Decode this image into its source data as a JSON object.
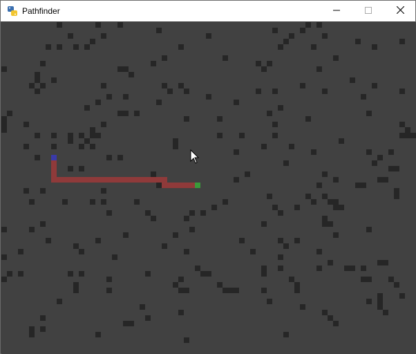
{
  "window": {
    "title": "Pathfinder",
    "icon": "python-icon",
    "controls": [
      "minimize-icon",
      "maximize-icon",
      "close-icon"
    ]
  },
  "grid": {
    "cell_size": 8,
    "cols": 75,
    "rows": 60,
    "colors": {
      "background": "#414141",
      "wall": "#262626",
      "path": "#8f3a3a",
      "start": "#3a3aa8",
      "end": "#3a9a3a"
    },
    "walls": [
      [
        10,
        0
      ],
      [
        17,
        0
      ],
      [
        21,
        0
      ],
      [
        55,
        0
      ],
      [
        57,
        0
      ],
      [
        28,
        1
      ],
      [
        49,
        1
      ],
      [
        54,
        1
      ],
      [
        12,
        2
      ],
      [
        18,
        2
      ],
      [
        37,
        2
      ],
      [
        52,
        2
      ],
      [
        58,
        2
      ],
      [
        16,
        3
      ],
      [
        51,
        3
      ],
      [
        64,
        3
      ],
      [
        72,
        3
      ],
      [
        8,
        4
      ],
      [
        10,
        4
      ],
      [
        13,
        4
      ],
      [
        15,
        4
      ],
      [
        32,
        4
      ],
      [
        50,
        4
      ],
      [
        56,
        4
      ],
      [
        67,
        4
      ],
      [
        29,
        6
      ],
      [
        40,
        6
      ],
      [
        60,
        6
      ],
      [
        7,
        7
      ],
      [
        27,
        7
      ],
      [
        46,
        7
      ],
      [
        48,
        7
      ],
      [
        0,
        8
      ],
      [
        21,
        8
      ],
      [
        22,
        8
      ],
      [
        47,
        8
      ],
      [
        57,
        8
      ],
      [
        6,
        9
      ],
      [
        23,
        9
      ],
      [
        6,
        10
      ],
      [
        9,
        10
      ],
      [
        63,
        10
      ],
      [
        5,
        11
      ],
      [
        7,
        11
      ],
      [
        18,
        11
      ],
      [
        29,
        11
      ],
      [
        32,
        11
      ],
      [
        54,
        11
      ],
      [
        67,
        11
      ],
      [
        6,
        12
      ],
      [
        30,
        12
      ],
      [
        33,
        12
      ],
      [
        46,
        12
      ],
      [
        49,
        12
      ],
      [
        58,
        12
      ],
      [
        72,
        12
      ],
      [
        19,
        13
      ],
      [
        22,
        13
      ],
      [
        37,
        13
      ],
      [
        65,
        13
      ],
      [
        17,
        14
      ],
      [
        28,
        14
      ],
      [
        42,
        14
      ],
      [
        15,
        15
      ],
      [
        50,
        15
      ],
      [
        1,
        16
      ],
      [
        21,
        16
      ],
      [
        22,
        16
      ],
      [
        24,
        16
      ],
      [
        48,
        16
      ],
      [
        66,
        16
      ],
      [
        0,
        17
      ],
      [
        33,
        17
      ],
      [
        39,
        17
      ],
      [
        55,
        17
      ],
      [
        0,
        18
      ],
      [
        4,
        18
      ],
      [
        18,
        18
      ],
      [
        49,
        18
      ],
      [
        72,
        18
      ],
      [
        0,
        19
      ],
      [
        16,
        19
      ],
      [
        73,
        19
      ],
      [
        6,
        20
      ],
      [
        9,
        20
      ],
      [
        12,
        20
      ],
      [
        14,
        20
      ],
      [
        16,
        20
      ],
      [
        17,
        20
      ],
      [
        39,
        20
      ],
      [
        43,
        20
      ],
      [
        49,
        20
      ],
      [
        72,
        20
      ],
      [
        73,
        20
      ],
      [
        74,
        20
      ],
      [
        12,
        21
      ],
      [
        15,
        21
      ],
      [
        31,
        21
      ],
      [
        61,
        21
      ],
      [
        4,
        22
      ],
      [
        9,
        22
      ],
      [
        14,
        22
      ],
      [
        16,
        22
      ],
      [
        31,
        22
      ],
      [
        47,
        22
      ],
      [
        52,
        22
      ],
      [
        42,
        23
      ],
      [
        56,
        23
      ],
      [
        66,
        23
      ],
      [
        70,
        23
      ],
      [
        6,
        24
      ],
      [
        19,
        24
      ],
      [
        21,
        24
      ],
      [
        68,
        24
      ],
      [
        51,
        25
      ],
      [
        67,
        25
      ],
      [
        12,
        26
      ],
      [
        14,
        26
      ],
      [
        70,
        26
      ],
      [
        71,
        26
      ],
      [
        27,
        27
      ],
      [
        44,
        27
      ],
      [
        58,
        27
      ],
      [
        11,
        28
      ],
      [
        42,
        28
      ],
      [
        60,
        28
      ],
      [
        68,
        28
      ],
      [
        69,
        28
      ],
      [
        28,
        29
      ],
      [
        57,
        29
      ],
      [
        64,
        29
      ],
      [
        65,
        29
      ],
      [
        4,
        30
      ],
      [
        7,
        30
      ],
      [
        18,
        30
      ],
      [
        71,
        30
      ],
      [
        48,
        31
      ],
      [
        55,
        31
      ],
      [
        58,
        31
      ],
      [
        71,
        31
      ],
      [
        5,
        32
      ],
      [
        11,
        32
      ],
      [
        16,
        32
      ],
      [
        18,
        32
      ],
      [
        24,
        32
      ],
      [
        40,
        32
      ],
      [
        56,
        32
      ],
      [
        59,
        32
      ],
      [
        60,
        32
      ],
      [
        38,
        33
      ],
      [
        49,
        33
      ],
      [
        53,
        33
      ],
      [
        60,
        33
      ],
      [
        61,
        33
      ],
      [
        19,
        34
      ],
      [
        26,
        34
      ],
      [
        34,
        34
      ],
      [
        36,
        34
      ],
      [
        50,
        34
      ],
      [
        27,
        35
      ],
      [
        33,
        35
      ],
      [
        58,
        35
      ],
      [
        7,
        36
      ],
      [
        47,
        36
      ],
      [
        58,
        36
      ],
      [
        59,
        36
      ],
      [
        0,
        37
      ],
      [
        5,
        37
      ],
      [
        34,
        37
      ],
      [
        66,
        37
      ],
      [
        22,
        38
      ],
      [
        31,
        38
      ],
      [
        60,
        38
      ],
      [
        8,
        39
      ],
      [
        17,
        39
      ],
      [
        43,
        39
      ],
      [
        50,
        39
      ],
      [
        53,
        39
      ],
      [
        13,
        40
      ],
      [
        29,
        40
      ],
      [
        51,
        40
      ],
      [
        3,
        41
      ],
      [
        14,
        41
      ],
      [
        33,
        41
      ],
      [
        45,
        41
      ],
      [
        57,
        41
      ],
      [
        0,
        42
      ],
      [
        20,
        42
      ],
      [
        50,
        42
      ],
      [
        59,
        43
      ],
      [
        68,
        43
      ],
      [
        69,
        43
      ],
      [
        35,
        44
      ],
      [
        47,
        44
      ],
      [
        50,
        44
      ],
      [
        57,
        44
      ],
      [
        62,
        44
      ],
      [
        63,
        44
      ],
      [
        65,
        44
      ],
      [
        1,
        45
      ],
      [
        3,
        45
      ],
      [
        12,
        45
      ],
      [
        14,
        45
      ],
      [
        26,
        45
      ],
      [
        36,
        45
      ],
      [
        37,
        45
      ],
      [
        47,
        45
      ],
      [
        0,
        46
      ],
      [
        19,
        46
      ],
      [
        32,
        46
      ],
      [
        52,
        46
      ],
      [
        65,
        46
      ],
      [
        66,
        46
      ],
      [
        70,
        46
      ],
      [
        13,
        47
      ],
      [
        31,
        47
      ],
      [
        39,
        47
      ],
      [
        53,
        47
      ],
      [
        71,
        47
      ],
      [
        13,
        48
      ],
      [
        19,
        48
      ],
      [
        32,
        48
      ],
      [
        33,
        48
      ],
      [
        40,
        48
      ],
      [
        41,
        48
      ],
      [
        42,
        48
      ],
      [
        47,
        48
      ],
      [
        53,
        48
      ],
      [
        68,
        49
      ],
      [
        72,
        49
      ],
      [
        10,
        50
      ],
      [
        48,
        50
      ],
      [
        66,
        50
      ],
      [
        68,
        50
      ],
      [
        25,
        51
      ],
      [
        54,
        51
      ],
      [
        68,
        51
      ],
      [
        32,
        52
      ],
      [
        58,
        52
      ],
      [
        69,
        52
      ],
      [
        7,
        53
      ],
      [
        26,
        53
      ],
      [
        59,
        53
      ],
      [
        22,
        54
      ],
      [
        23,
        54
      ],
      [
        60,
        54
      ],
      [
        5,
        55
      ],
      [
        7,
        55
      ],
      [
        5,
        56
      ],
      [
        17,
        56
      ],
      [
        51,
        56
      ],
      [
        33,
        57
      ]
    ],
    "path": [
      [
        9,
        24
      ],
      [
        9,
        25
      ],
      [
        9,
        26
      ],
      [
        9,
        27
      ],
      [
        9,
        28
      ],
      [
        10,
        28
      ],
      [
        11,
        28
      ],
      [
        12,
        28
      ],
      [
        13,
        28
      ],
      [
        14,
        28
      ],
      [
        15,
        28
      ],
      [
        16,
        28
      ],
      [
        17,
        28
      ],
      [
        18,
        28
      ],
      [
        19,
        28
      ],
      [
        20,
        28
      ],
      [
        21,
        28
      ],
      [
        22,
        28
      ],
      [
        23,
        28
      ],
      [
        24,
        28
      ],
      [
        25,
        28
      ],
      [
        26,
        28
      ],
      [
        27,
        28
      ],
      [
        28,
        28
      ],
      [
        29,
        28
      ],
      [
        29,
        29
      ],
      [
        30,
        29
      ],
      [
        31,
        29
      ],
      [
        32,
        29
      ],
      [
        33,
        29
      ],
      [
        34,
        29
      ]
    ],
    "start": [
      9,
      24
    ],
    "end": [
      35,
      29
    ]
  },
  "cursor": "mouse-pointer-icon"
}
